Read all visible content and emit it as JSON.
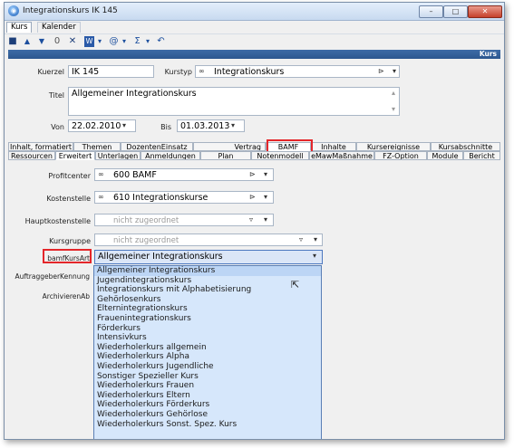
{
  "window": {
    "title": "Integrationskurs IK 145",
    "controls": [
      "–",
      "□",
      "✕"
    ]
  },
  "menu": [
    "Kurs",
    "Kalender"
  ],
  "toolbar": {
    "icons": [
      "save-icon",
      "up-arrow-icon",
      "down-arrow-icon",
      "attach-icon",
      "delete-icon",
      "word-icon",
      "globe-icon",
      "sum-icon",
      "undo-icon"
    ],
    "glyphs": {
      "save": "■",
      "up": "▲",
      "down": "▼",
      "attach": "0",
      "delete": "✕",
      "word": "W",
      "globe": "@",
      "sum": "Σ",
      "undo": "↶",
      "caret": "▾"
    }
  },
  "header": {
    "label": "Kurs"
  },
  "form": {
    "kuerzel_label": "Kuerzel",
    "kuerzel_value": "IK 145",
    "kurstyp_label": "Kurstyp",
    "kurstyp_value": "Integrationskurs",
    "titel_label": "Titel",
    "titel_value": "Allgemeiner Integrationskurs",
    "von_label": "Von",
    "von_value": "22.02.2010",
    "bis_label": "Bis",
    "bis_value": "01.03.2013"
  },
  "tabs_row1": [
    "Inhalt, formatiert",
    "Themen",
    "DozentenEinsatz",
    "Vertrag",
    "BAMF",
    "Inhalte",
    "Kursereignisse",
    "Kursabschnitte"
  ],
  "tabs_row2": [
    "Ressourcen",
    "Erweitert",
    "Unterlagen",
    "Anmeldungen",
    "Plan",
    "Notenmodell",
    "eMawMaßnahme",
    "FZ-Option",
    "Module",
    "Bericht"
  ],
  "bamf": {
    "profitcenter_label": "Profitcenter",
    "profitcenter_value": "600 BAMF",
    "kostenstelle_label": "Kostenstelle",
    "kostenstelle_value": "610 Integrationskurse",
    "hauptkostenstelle_label": "Hauptkostenstelle",
    "hauptkostenstelle_value": "nicht zugeordnet",
    "kursgruppe_label": "Kursgruppe",
    "kursgruppe_value": "nicht zugeordnet",
    "kursart_label": "bamfKursArt",
    "kursart_value": "Allgemeiner Integrationskurs",
    "auftraggeber_label": "AuftraggeberKennung",
    "archivieren_label": "ArchivierenAb"
  },
  "kursart_options": [
    "Allgemeiner Integrationskurs",
    "Jugendintegrationskurs",
    "Integrationskurs mit Alphabetisierung",
    "Gehörlosenkurs",
    "Elternintegrationskurs",
    "Frauenintegrationskurs",
    "Förderkurs",
    "Intensivkurs",
    "Wiederholerkurs allgemein",
    "Wiederholerkurs Alpha",
    "Wiederholerkurs Jugendliche",
    "Sonstiger Spezieller Kurs",
    "Wiederholerkurs Frauen",
    "Wiederholerkurs Eltern",
    "Wiederholerkurs Förderkurs",
    "Wiederholerkurs Gehörlose",
    "Wiederholerkurs Sonst. Spez. Kurs"
  ]
}
